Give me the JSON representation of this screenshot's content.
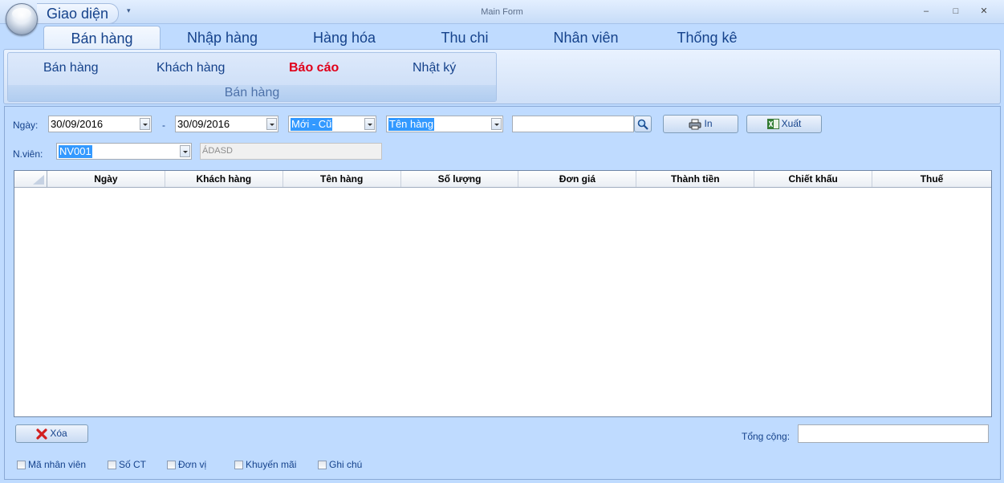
{
  "window": {
    "app_title": "Giao diện",
    "title": "Main Form",
    "minimize": "‒",
    "maximize": "□",
    "close": "✕"
  },
  "ribbon": {
    "tabs": [
      {
        "label": "Bán hàng",
        "active": true
      },
      {
        "label": "Nhập hàng"
      },
      {
        "label": "Hàng hóa"
      },
      {
        "label": "Thu chi"
      },
      {
        "label": "Nhân viên"
      },
      {
        "label": "Thống kê"
      }
    ],
    "group": {
      "items": [
        "Bán hàng",
        "Khách hàng",
        "Báo cáo",
        "Nhật ký"
      ],
      "label": "Bán hàng"
    }
  },
  "filters": {
    "date_label": "Ngày:",
    "date_from": "30/09/2016",
    "date_sep": "-",
    "date_to": "30/09/2016",
    "sort_value": "Mới - Cũ",
    "field_value": "Tên hàng",
    "search_value": "",
    "print_label": "In",
    "export_label": "Xuất",
    "employee_label": "N.viên:",
    "employee_value": "NV001",
    "employee_name": "ÁDASD"
  },
  "grid": {
    "columns": [
      "Ngày",
      "Khách hàng",
      "Tên hàng",
      "Số lượng",
      "Đơn giá",
      "Thành tiền",
      "Chiết khấu",
      "Thuế"
    ],
    "rows": []
  },
  "footer": {
    "delete_label": "Xóa",
    "total_label": "Tổng cộng:",
    "total_value": "",
    "checkboxes": [
      "Mã nhân viên",
      "Số CT",
      "Đơn vị",
      "Khuyến mãi",
      "Ghi chú"
    ]
  },
  "icons": {
    "orb": "app-orb-icon",
    "search": "magnifier-icon",
    "print": "printer-icon",
    "export": "excel-icon",
    "delete": "red-x-icon"
  }
}
